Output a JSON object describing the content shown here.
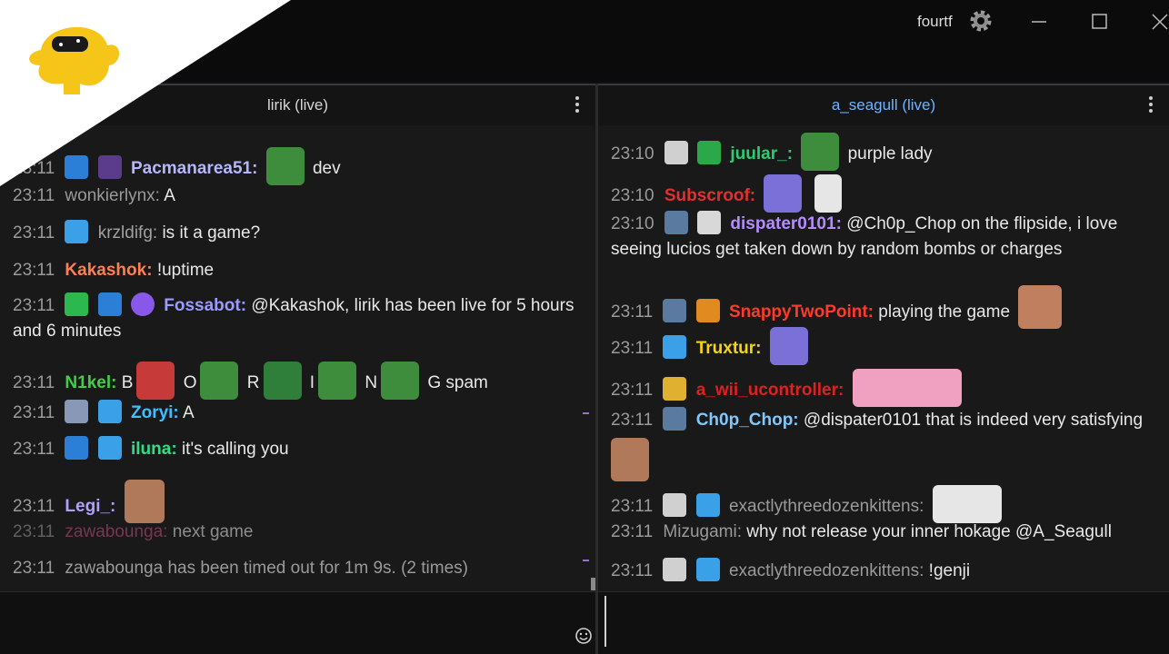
{
  "window": {
    "user": "fourtf",
    "gear_icon": "gear-icon",
    "minimize_icon": "minimize-icon",
    "maximize_icon": "maximize-icon"
  },
  "left_pane": {
    "title": "lirik (live)",
    "messages": [
      {
        "time": "23:11",
        "user": "Pacmanarea51:",
        "user_color": "#b6b6ff",
        "text": "dev"
      },
      {
        "time": "23:11",
        "user": "wonkierlynx:",
        "user_color": "#9a9a9a",
        "text": "A"
      },
      {
        "time": "23:11",
        "user": "krzldifg:",
        "user_color": "#a0a0a0",
        "text": "is it a game?"
      },
      {
        "time": "23:11",
        "user": "Kakashok:",
        "user_color": "#ff7f50",
        "text": "!uptime"
      },
      {
        "time": "23:11",
        "user": "Fossabot:",
        "user_color": "#9b9bff",
        "text": "@Kakashok, lirik has been live for 5 hours and 6 minutes"
      },
      {
        "time": "23:11",
        "user": "N1kel:",
        "user_color": "#3fd13f",
        "text_parts": [
          "B",
          "O",
          "R",
          "I",
          "N",
          "G spam"
        ]
      },
      {
        "time": "23:11",
        "user": "Zoryi:",
        "user_color": "#3fbfff",
        "text": "A"
      },
      {
        "time": "23:11",
        "user": "iluna:",
        "user_color": "#33dd88",
        "text": "it's calling you"
      },
      {
        "time": "23:11",
        "user": "Legi_:",
        "user_color": "#b0a0ff",
        "text": ""
      },
      {
        "time": "23:11",
        "user": "zawabounga:",
        "user_color": "#8a3a5a",
        "text": "next game"
      },
      {
        "time": "23:11",
        "text": "zawabounga has been timed out for 1m 9s. (2 times)"
      }
    ]
  },
  "right_pane": {
    "title": "a_seagull (live)",
    "messages": [
      {
        "time": "23:10",
        "user": "juular_:",
        "user_color": "#2ecc71",
        "text": "purple lady"
      },
      {
        "time": "23:10",
        "user": "Subscroof:",
        "user_color": "#e03030",
        "text": ""
      },
      {
        "time": "23:10",
        "user": "dispater0101:",
        "user_color": "#b58cff",
        "text": "@Ch0p_Chop on the flipside, i love seeing lucios get taken down by random bombs or charges"
      },
      {
        "time": "23:11",
        "user": "SnappyTwoPoint:",
        "user_color": "#ff3a2a",
        "text": "playing the game"
      },
      {
        "time": "23:11",
        "user": "Truxtur:",
        "user_color": "#f5d50a",
        "text": ""
      },
      {
        "time": "23:11",
        "user": "a_wii_ucontroller:",
        "user_color": "#e02020",
        "text": ""
      },
      {
        "time": "23:11",
        "user": "Ch0p_Chop:",
        "user_color": "#7fc8ff",
        "text": "@dispater0101 that is indeed very satisfying"
      },
      {
        "time": "23:11",
        "user": "exactlythreedozenkittens:",
        "user_color": "#9a9a9a",
        "text": ""
      },
      {
        "time": "23:11",
        "user": "Mizugami:",
        "user_color": "#9a9a9a",
        "text": "why not release your inner hokage @A_Seagull"
      },
      {
        "time": "23:11",
        "user": "exactlythreedozenkittens:",
        "user_color": "#9a9a9a",
        "text": "!genji"
      }
    ]
  }
}
